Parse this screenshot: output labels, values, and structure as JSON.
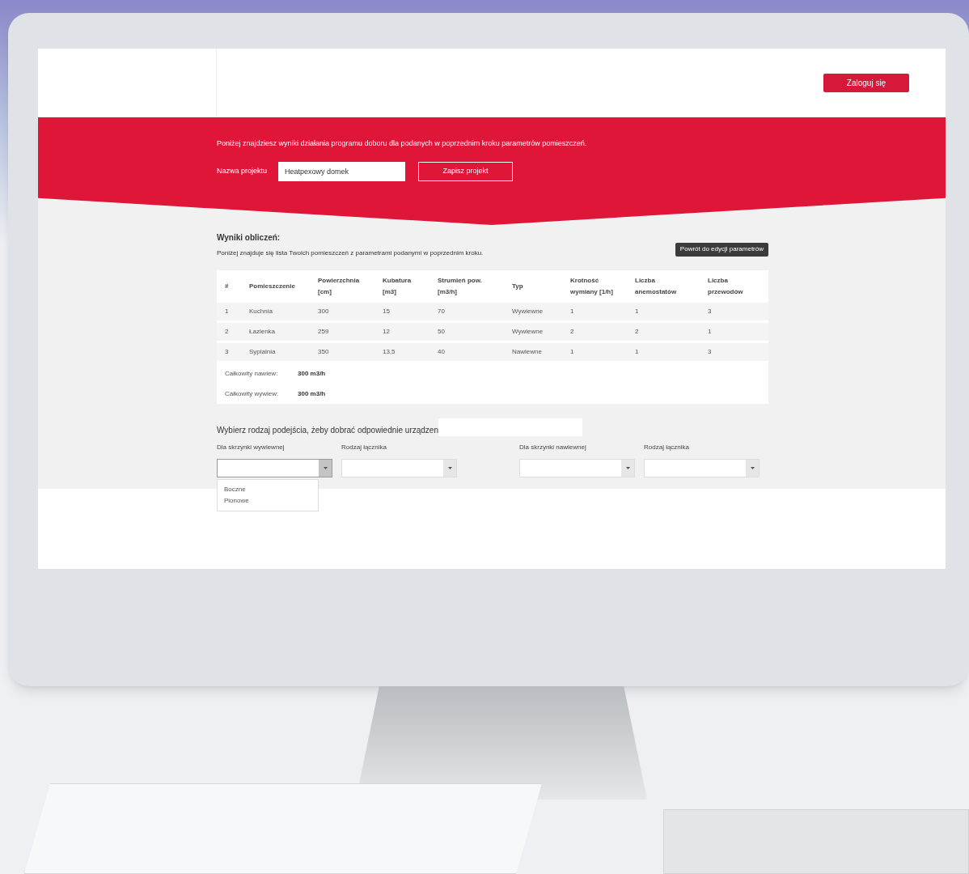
{
  "header": {
    "login_button": "Zaloguj się"
  },
  "banner": {
    "intro": "Poniżej znajdziesz wyniki działania programu doboru dla podanych w poprzednim kroku parametrów pomieszczeń.",
    "project_label": "Nazwa projektu",
    "project_name": "Heatpexowy domek",
    "save_button": "Zapisz projekt"
  },
  "results": {
    "title": "Wyniki obliczeń:",
    "description": "Poniżej znajduje się lista Twoich pomieszczeń z parametrami podanymi w poprzednim kroku.",
    "back_button": "Powrót do edycji parametrów",
    "columns": [
      "#",
      "Pomieszczenie",
      "Powierzchnia [cm]",
      "Kubatura [m3]",
      "Strumień pow. [m3/h]",
      "Typ",
      "Krotność wymiany [1/h]",
      "Liczba anemostatów",
      "Liczba przewodów"
    ],
    "rows": [
      [
        "1",
        "Kuchnia",
        "300",
        "15",
        "70",
        "Wywiewne",
        "1",
        "1",
        "3"
      ],
      [
        "2",
        "Łazienka",
        "259",
        "12",
        "50",
        "Wywiewne",
        "2",
        "2",
        "1"
      ],
      [
        "3",
        "Sypialnia",
        "350",
        "13,5",
        "40",
        "Nawiewne",
        "1",
        "1",
        "3"
      ]
    ],
    "totals": [
      {
        "label": "Całkowity nawiew:",
        "value": "300 m3/h"
      },
      {
        "label": "Całkowity wywiew:",
        "value": "300 m3/h"
      }
    ]
  },
  "selection": {
    "prompt": "Wybierz rodzaj podejścia, żeby dobrać odpowiednie urządzen",
    "selects": [
      {
        "label": "Dla skrzynki wywiewnej",
        "expanded": true,
        "options": [
          "Boczne",
          "Pionowe"
        ]
      },
      {
        "label": "Rodzaj łącznika",
        "expanded": false
      },
      {
        "label": "Dla skrzynki nawiewnej",
        "expanded": false
      },
      {
        "label": "Rodzaj łącznika",
        "expanded": false
      }
    ]
  }
}
